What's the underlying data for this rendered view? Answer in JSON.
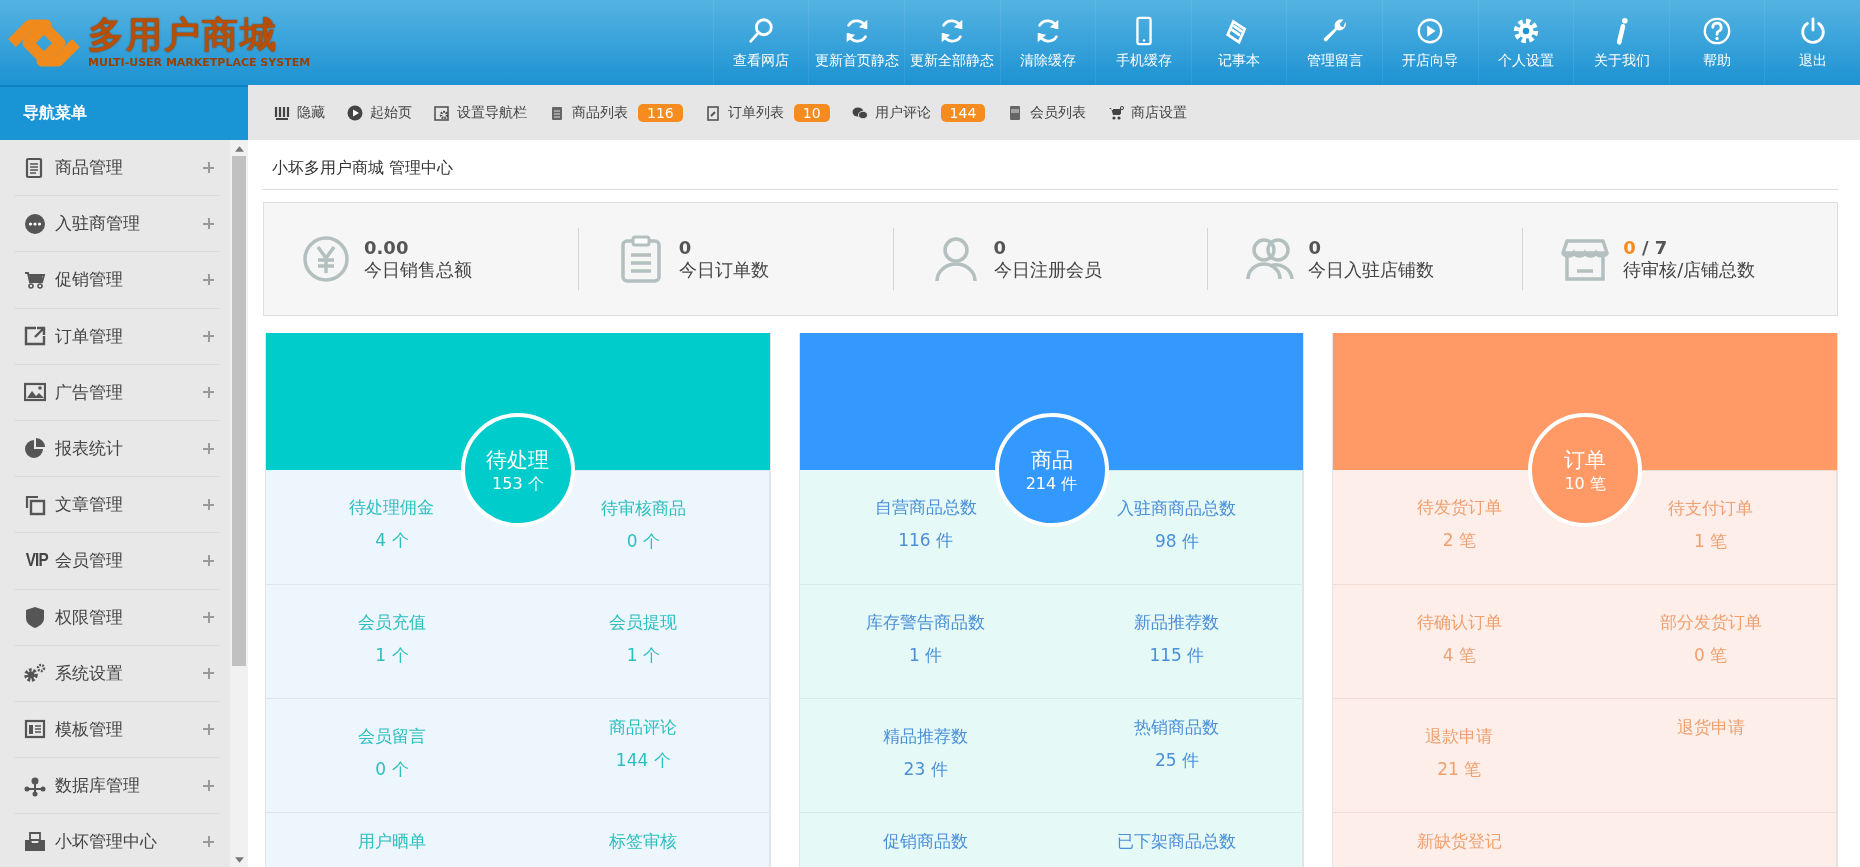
{
  "header": {
    "logo_title": "多用户商城",
    "logo_subtitle": "MULTI-USER MARKETPLACE SYSTEM",
    "actions": [
      {
        "label": "查看网店"
      },
      {
        "label": "更新首页静态"
      },
      {
        "label": "更新全部静态"
      },
      {
        "label": "清除缓存"
      },
      {
        "label": "手机缓存"
      },
      {
        "label": "记事本"
      },
      {
        "label": "管理留言"
      },
      {
        "label": "开店向导"
      },
      {
        "label": "个人设置"
      },
      {
        "label": "关于我们"
      },
      {
        "label": "帮助"
      },
      {
        "label": "退出"
      }
    ]
  },
  "sidebar": {
    "title": "导航菜单",
    "items": [
      {
        "label": "商品管理"
      },
      {
        "label": "入驻商管理"
      },
      {
        "label": "促销管理"
      },
      {
        "label": "订单管理"
      },
      {
        "label": "广告管理"
      },
      {
        "label": "报表统计"
      },
      {
        "label": "文章管理"
      },
      {
        "label": "会员管理",
        "icon_text": "VIP"
      },
      {
        "label": "权限管理"
      },
      {
        "label": "系统设置"
      },
      {
        "label": "模板管理"
      },
      {
        "label": "数据库管理"
      },
      {
        "label": "小坏管理中心"
      }
    ]
  },
  "toolbar": [
    {
      "label": "隐藏"
    },
    {
      "label": "起始页"
    },
    {
      "label": "设置导航栏"
    },
    {
      "label": "商品列表",
      "badge": "116"
    },
    {
      "label": "订单列表",
      "badge": "10"
    },
    {
      "label": "用户评论",
      "badge": "144"
    },
    {
      "label": "会员列表"
    },
    {
      "label": "商店设置"
    }
  ],
  "page_title": "小坏多用户商城 管理中心",
  "stats": [
    {
      "value": "0.00",
      "label": "今日销售总额"
    },
    {
      "value": "0",
      "label": "今日订单数"
    },
    {
      "value": "0",
      "label": "今日注册会员"
    },
    {
      "value": "0",
      "label": "今日入驻店铺数"
    },
    {
      "highlight": "0",
      "value": "/ 7",
      "label": "待审核/店铺总数"
    }
  ],
  "cards": [
    {
      "title": "待处理",
      "count": "153 个",
      "color": "#00cccc",
      "cells": [
        {
          "label": "待处理佣金",
          "value": "4 个"
        },
        {
          "label": "待审核商品",
          "value": "0 个"
        },
        {
          "label": "会员充值",
          "value": "1 个"
        },
        {
          "label": "会员提现",
          "value": "1 个"
        },
        {
          "label": "会员留言",
          "value": "0 个"
        },
        {
          "label": "商品评论",
          "value": "144 个"
        },
        {
          "label": "用户晒单"
        },
        {
          "label": "标签审核"
        }
      ]
    },
    {
      "title": "商品",
      "count": "214 件",
      "color": "#3399ff",
      "cells": [
        {
          "label": "自营商品总数",
          "value": "116 件"
        },
        {
          "label": "入驻商商品总数",
          "value": "98 件"
        },
        {
          "label": "库存警告商品数",
          "value": "1 件"
        },
        {
          "label": "新品推荐数",
          "value": "115 件"
        },
        {
          "label": "精品推荐数",
          "value": "23 件"
        },
        {
          "label": "热销商品数",
          "value": "25 件"
        },
        {
          "label": "促销商品数"
        },
        {
          "label": "已下架商品总数"
        }
      ]
    },
    {
      "title": "订单",
      "count": "10 笔",
      "color": "#ff9966",
      "cells": [
        {
          "label": "待发货订单",
          "value": "2 笔"
        },
        {
          "label": "待支付订单",
          "value": "1 笔"
        },
        {
          "label": "待确认订单",
          "value": "4 笔"
        },
        {
          "label": "部分发货订单",
          "value": "0 笔"
        },
        {
          "label": "退款申请",
          "value": "21 笔"
        },
        {
          "label": "退货申请"
        },
        {
          "label": "新缺货登记"
        },
        {}
      ]
    }
  ]
}
